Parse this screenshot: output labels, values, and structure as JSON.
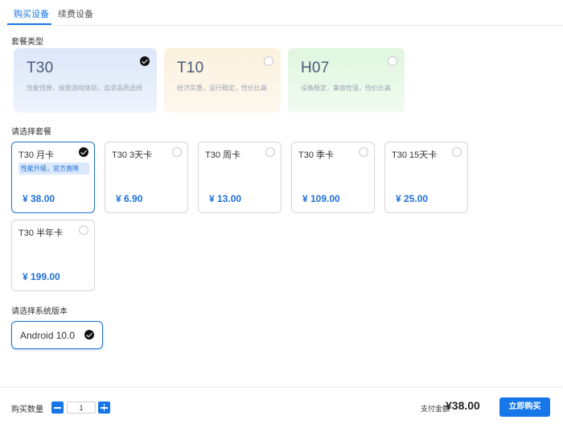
{
  "tabs": [
    {
      "label": "购买设备",
      "active": true
    },
    {
      "label": "续费设备",
      "active": false
    }
  ],
  "sections": {
    "package_type": "套餐类型",
    "choose_plan": "请选择套餐",
    "choose_system": "请选择系统版本"
  },
  "packages": [
    {
      "name": "T30",
      "desc": "性能怪兽，极致游戏体验，追求品质选择",
      "selected": true
    },
    {
      "name": "T10",
      "desc": "经济实惠，运行稳定，性价比高",
      "selected": false
    },
    {
      "name": "H07",
      "desc": "设备稳定，兼容性强，性价比高",
      "selected": false
    }
  ],
  "plans": [
    {
      "name": "T30 月卡",
      "tag": "性能升级，官方直降",
      "price": "¥ 38.00",
      "selected": true
    },
    {
      "name": "T30 3天卡",
      "price": "¥ 6.90",
      "selected": false
    },
    {
      "name": "T30 周卡",
      "price": "¥ 13.00",
      "selected": false
    },
    {
      "name": "T30 季卡",
      "price": "¥ 109.00",
      "selected": false
    },
    {
      "name": "T30 15天卡",
      "price": "¥ 25.00",
      "selected": false
    },
    {
      "name": "T30 半年卡",
      "price": "¥ 199.00",
      "selected": false
    }
  ],
  "system": {
    "label": "Android 10.0",
    "selected": true
  },
  "footer": {
    "qty_label": "购买数量",
    "qty_value": "1",
    "pay_label": "支付金额",
    "pay_amount": "¥38.00",
    "buy_label": "立即购买"
  },
  "colors": {
    "accent": "#1677e8",
    "price": "#1e6ed8",
    "tag_bg": "#dbe8fb"
  }
}
